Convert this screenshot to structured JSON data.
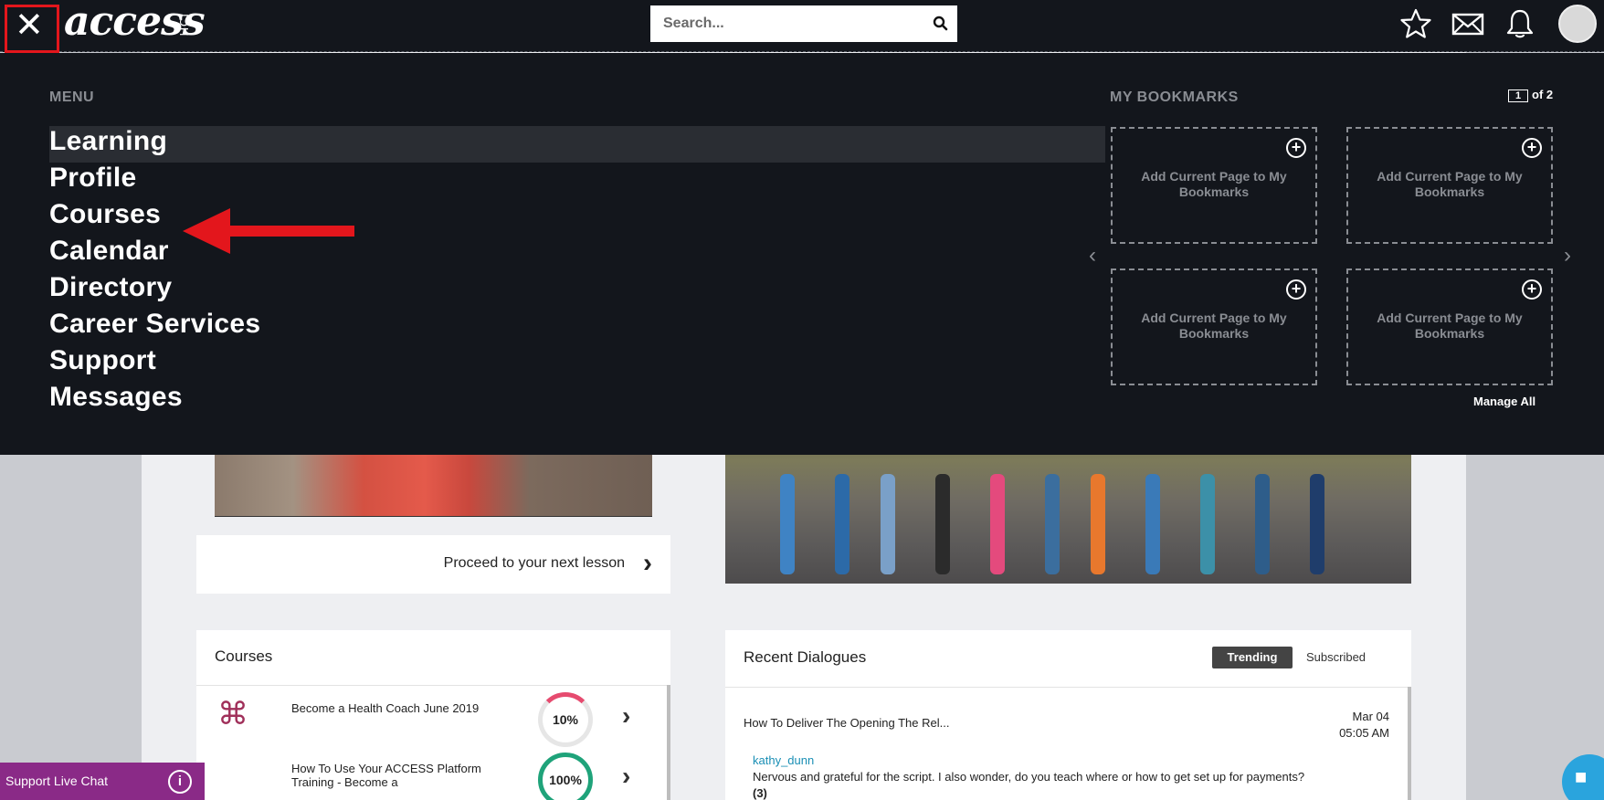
{
  "header": {
    "logo_text": "access",
    "logo_sub": "HCI",
    "search_placeholder": "Search..."
  },
  "menu": {
    "heading": "MENU",
    "items": [
      "Learning",
      "Profile",
      "Courses",
      "Calendar",
      "Directory",
      "Career Services",
      "Support",
      "Messages"
    ],
    "active_item": "Learning"
  },
  "bookmarks": {
    "heading": "MY BOOKMARKS",
    "page_current": "1",
    "page_of": "of 2",
    "slot_label": "Add Current Page to My Bookmarks",
    "manage_all": "Manage All"
  },
  "lesson": {
    "proceed_label": "Proceed to your next lesson"
  },
  "courses": {
    "title": "Courses",
    "items": [
      {
        "name": "Become a Health Coach June 2019",
        "progress": "10%",
        "progress_fraction": 0.1
      },
      {
        "name": "How To Use Your ACCESS Platform Training - Become a",
        "progress": "100%",
        "progress_fraction": 1.0
      }
    ]
  },
  "dialogues": {
    "title": "Recent Dialogues",
    "tab_trending": "Trending",
    "tab_subscribed": "Subscribed",
    "topic": "How To Deliver The Opening The Rel...",
    "date": "Mar 04",
    "time": "05:05 AM",
    "user": "kathy_dunn",
    "message": "Nervous and grateful for the script. I also wonder, do you teach where or how to get set up for payments?",
    "reply_count": "(3)"
  },
  "support_chat": {
    "label": "Support Live Chat"
  },
  "colors": {
    "overlay_bg": "#13161c",
    "highlight_red": "#e3161c",
    "chat_purple": "#8a2a87",
    "link_blue": "#1a8fb5"
  }
}
